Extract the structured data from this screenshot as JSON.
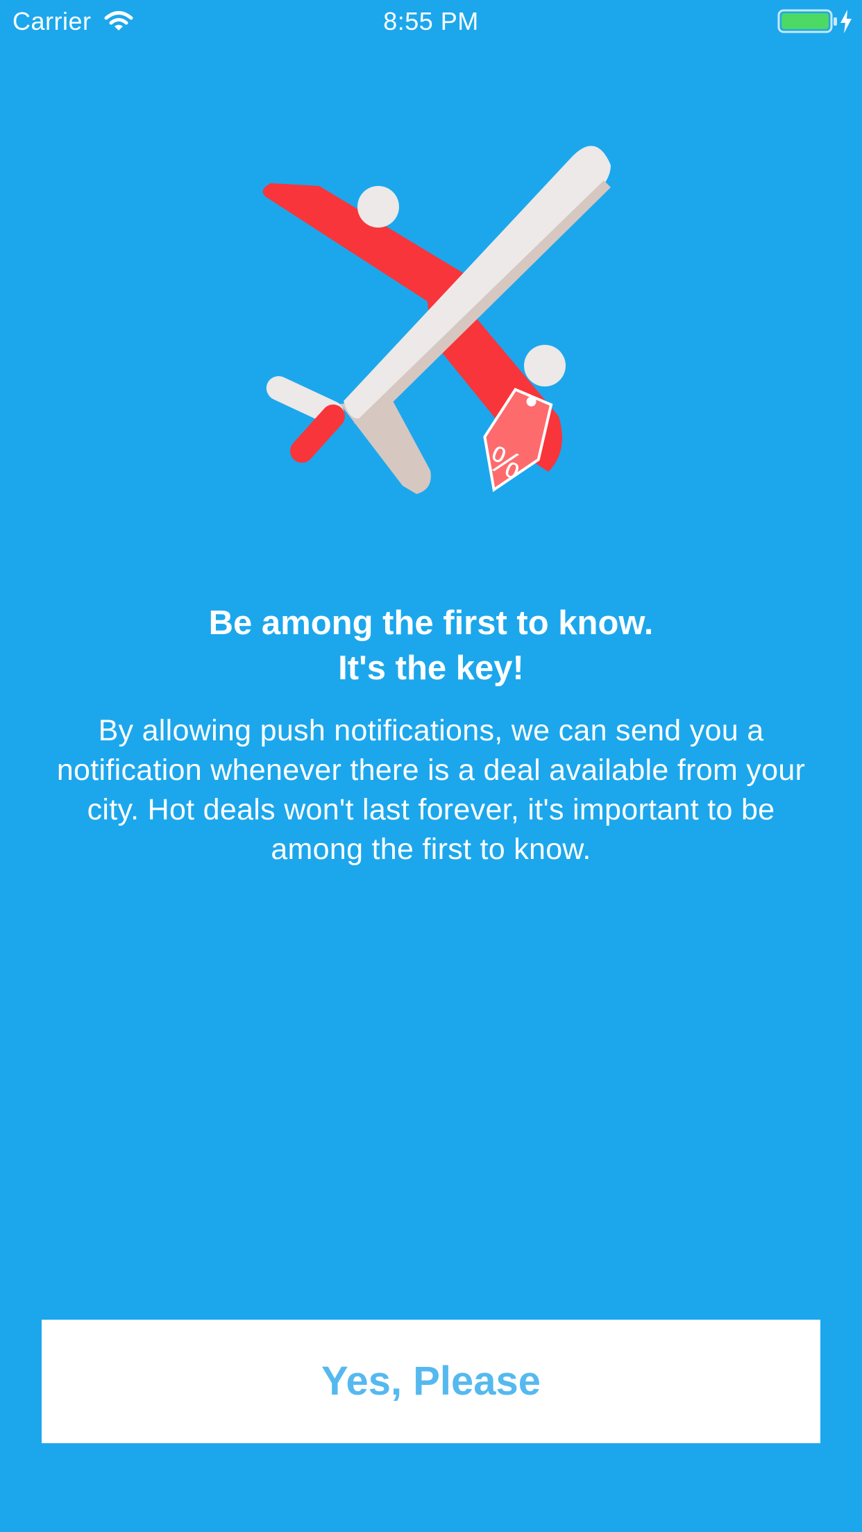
{
  "status_bar": {
    "carrier": "Carrier",
    "time": "8:55 PM",
    "icons": [
      "wifi-icon",
      "battery-icon",
      "charging-icon"
    ],
    "battery_color": "#4cd964"
  },
  "hero": {
    "icon": "airplane-sale-tag-icon",
    "tag_text": "%",
    "colors": {
      "body": "#ece9e8",
      "shade": "#d6c7c1",
      "wing": "#f8353a",
      "tag": "#fd6b6d"
    }
  },
  "content": {
    "headline_line_1": "Be among the first to know.",
    "headline_line_2": "It's the key!",
    "body": "By allowing push notifications, we can send you a notification whenever there is a deal available from your city. Hot deals won't last forever, it's important to be among the first to know."
  },
  "actions": {
    "primary_label": "Yes, Please"
  },
  "theme": {
    "background": "#1ca7ec",
    "button_background": "#ffffff",
    "button_text": "#55b9ef"
  }
}
